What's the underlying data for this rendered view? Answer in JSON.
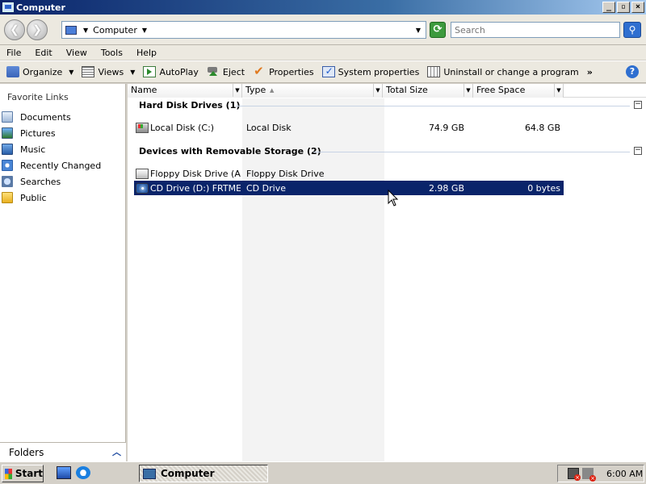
{
  "window": {
    "title": "Computer",
    "buttons": {
      "minimize": "_",
      "maximize": "▫",
      "close": "×"
    }
  },
  "address": {
    "crumb": "Computer",
    "search_placeholder": "Search"
  },
  "menu": [
    "File",
    "Edit",
    "View",
    "Tools",
    "Help"
  ],
  "toolbar": {
    "organize": "Organize",
    "views": "Views",
    "autoplay": "AutoPlay",
    "eject": "Eject",
    "properties": "Properties",
    "system_properties": "System properties",
    "uninstall": "Uninstall or change a program",
    "more": "»",
    "help": "?"
  },
  "sidebar": {
    "title": "Favorite Links",
    "items": [
      {
        "label": "Documents",
        "icon": "documents-icon"
      },
      {
        "label": "Pictures",
        "icon": "pictures-icon"
      },
      {
        "label": "Music",
        "icon": "music-icon"
      },
      {
        "label": "Recently Changed",
        "icon": "recently-changed-icon"
      },
      {
        "label": "Searches",
        "icon": "searches-icon"
      },
      {
        "label": "Public",
        "icon": "public-folder-icon"
      }
    ],
    "folders_label": "Folders"
  },
  "columns": [
    "Name",
    "Type",
    "Total Size",
    "Free Space"
  ],
  "groups": [
    {
      "title": "Hard Disk Drives (1)",
      "items": [
        {
          "name": "Local Disk (C:)",
          "type": "Local Disk",
          "total": "74.9 GB",
          "free": "64.8 GB",
          "icon": "hard-disk-icon",
          "selected": false
        }
      ]
    },
    {
      "title": "Devices with Removable Storage (2)",
      "items": [
        {
          "name": "Floppy Disk Drive (A:)",
          "type": "Floppy Disk Drive",
          "total": "",
          "free": "",
          "icon": "floppy-drive-icon",
          "selected": false
        },
        {
          "name": "CD Drive (D:) FRTME...",
          "type": "CD Drive",
          "total": "2.98 GB",
          "free": "0 bytes",
          "icon": "cd-drive-icon",
          "selected": true
        }
      ]
    }
  ],
  "taskbar": {
    "start": "Start",
    "task_item": "Computer",
    "clock": "6:00 AM"
  },
  "colors": {
    "selection": "#0a246a",
    "titlebar": "#0a246a",
    "window_bg": "#d4d0c8"
  }
}
